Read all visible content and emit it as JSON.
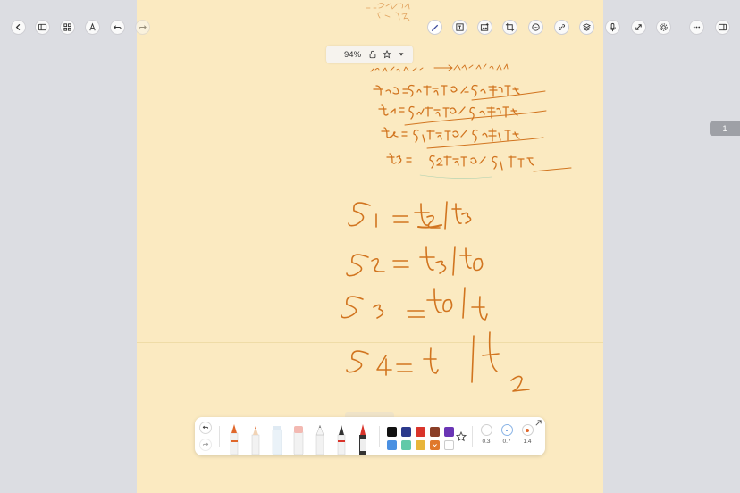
{
  "toolbar": {
    "left_icons": [
      "back-icon",
      "sidebar-icon",
      "grid-icon",
      "pen-mode-icon",
      "undo-icon",
      "redo-icon"
    ],
    "tool_icons": [
      "pen-tool-icon",
      "text-box-icon",
      "insert-image-icon",
      "crop-icon",
      "comment-icon",
      "link-icon",
      "layers-icon",
      "microphone-icon",
      "fullscreen-icon",
      "settings-icon"
    ],
    "right_icons": [
      "more-icon",
      "split-view-icon"
    ]
  },
  "zoom_bar": {
    "zoom": "94%"
  },
  "page_indicator": "1",
  "palette": {
    "colors_row1": [
      "#111111",
      "#2c3a8c",
      "#d9342b",
      "#8a3f28",
      "#6a35b5"
    ],
    "colors_row2": [
      "#4a90e2",
      "#61c9a8",
      "#e8b53a",
      "#e0782b",
      "#ffffff"
    ],
    "selected_color": "#e0782b",
    "sizes": [
      "0.3",
      "0.7",
      "1.4"
    ],
    "selected_size": "1.4",
    "accent": "#e0672a"
  },
  "handwriting": {
    "note_lines": [
      "t0 = S3前3位 与 S2后5位",
      "t1 = S4前3位 与 S3后5位",
      "t2 = S1前3位 与 S3末5位",
      "t3 = S2前3位 与 S1后5位"
    ],
    "equations": [
      "S1 = t2 | t3",
      "S2 = t3 | t0",
      "S3 = t0 | t1",
      "S4 = t1 | t2"
    ]
  }
}
